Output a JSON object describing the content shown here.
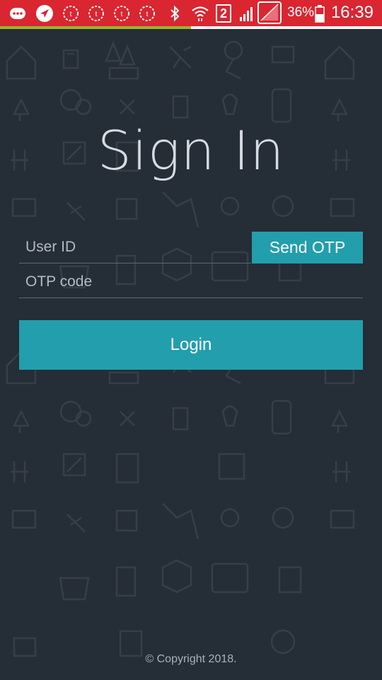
{
  "status_bar": {
    "battery_text": "36%",
    "time": "16:39",
    "sim_label": "2",
    "progress_fraction": 0.5,
    "colors": {
      "background": "#d92631",
      "progress": "#9ab52a"
    },
    "icons": [
      "chat-icon",
      "navigation-icon",
      "notification-icon",
      "notification-icon",
      "notification-icon",
      "notification-icon",
      "bluetooth-icon",
      "wifi-icon",
      "sim-icon",
      "signal-icon",
      "no-signal-icon",
      "battery-icon"
    ]
  },
  "title": "Sign In",
  "form": {
    "user_id_placeholder": "User ID",
    "otp_placeholder": "OTP code",
    "send_otp_label": "Send OTP",
    "login_label": "Login"
  },
  "footer": {
    "copyright": "© Copyright 2018."
  },
  "colors": {
    "background": "#252d37",
    "accent": "#239ead",
    "title": "#d6dbe0"
  }
}
